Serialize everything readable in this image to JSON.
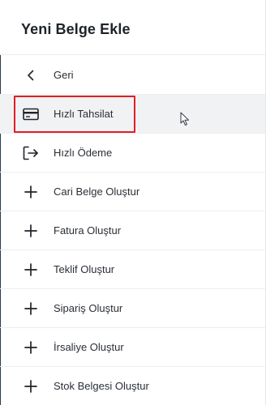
{
  "header": {
    "title": "Yeni Belge Ekle"
  },
  "menu": {
    "items": [
      {
        "label": "Geri",
        "icon": "chevron-left-icon"
      },
      {
        "label": "Hızlı Tahsilat",
        "icon": "credit-card-icon"
      },
      {
        "label": "Hızlı Ödeme",
        "icon": "logout-icon"
      },
      {
        "label": "Cari Belge Oluştur",
        "icon": "plus-icon"
      },
      {
        "label": "Fatura Oluştur",
        "icon": "plus-icon"
      },
      {
        "label": "Teklif Oluştur",
        "icon": "plus-icon"
      },
      {
        "label": "Sipariş Oluştur",
        "icon": "plus-icon"
      },
      {
        "label": "İrsaliye Oluştur",
        "icon": "plus-icon"
      },
      {
        "label": "Stok Belgesi Oluştur",
        "icon": "plus-icon"
      }
    ]
  },
  "colors": {
    "highlight": "#e11d22",
    "active_row": "#f1f2f4",
    "text": "#2a2f36"
  }
}
